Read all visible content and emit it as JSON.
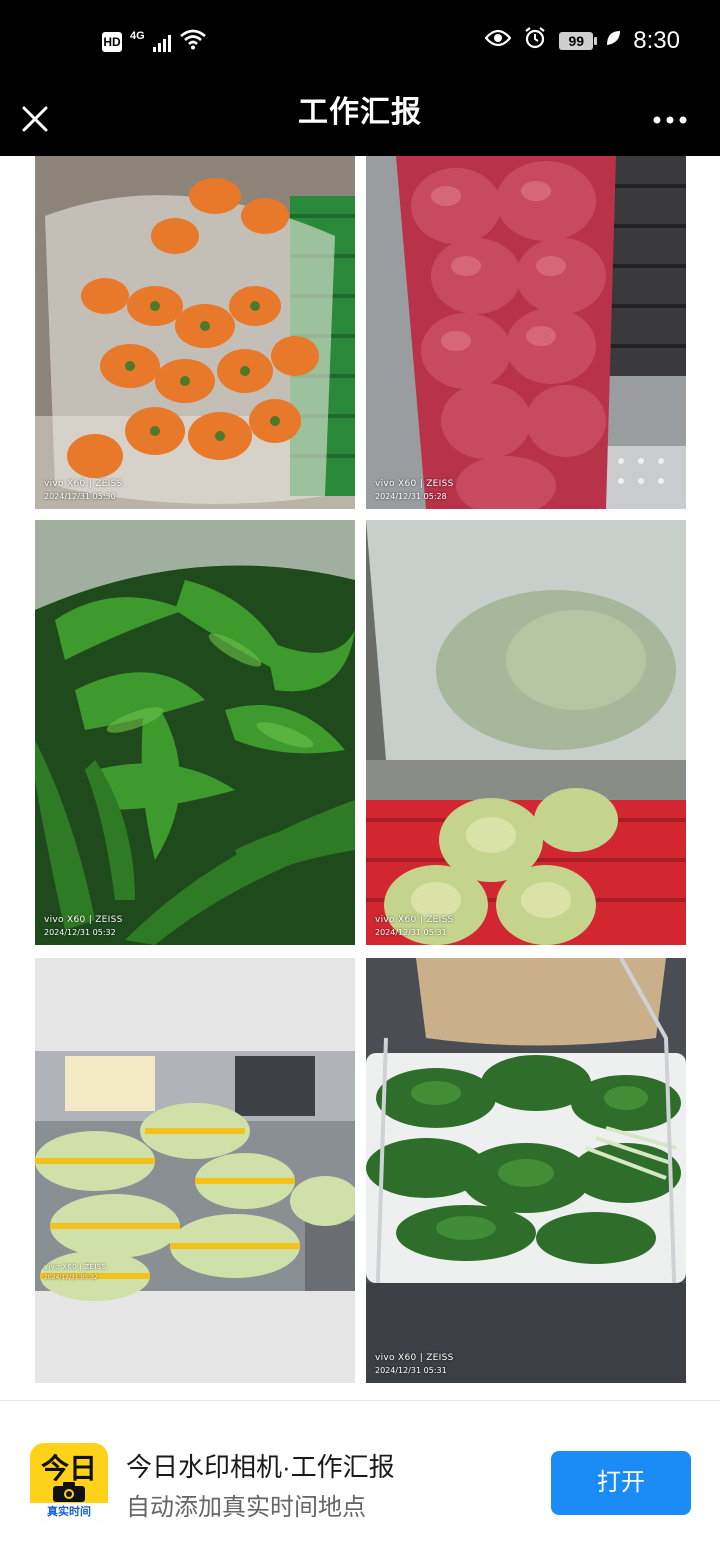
{
  "status_bar": {
    "hd_badge": "HD",
    "network": "4G",
    "battery": "99",
    "time": "8:30"
  },
  "header": {
    "title": "工作汇报",
    "close_icon": "close-icon",
    "more_icon": "more-icon"
  },
  "photos": [
    {
      "subject": "carrots",
      "brand": "vivo X60 | ZEISS",
      "timestamp": "2024/12/31 05:30"
    },
    {
      "subject": "red-onions",
      "brand": "vivo X60 | ZEISS",
      "timestamp": "2024/12/31 05:28"
    },
    {
      "subject": "green-peppers-cucumbers",
      "brand": "vivo X60 | ZEISS",
      "timestamp": "2024/12/31 05:32"
    },
    {
      "subject": "cabbage",
      "brand": "vivo X60 | ZEISS",
      "timestamp": "2024/12/31 05:31"
    },
    {
      "subject": "napa-cabbage",
      "brand": "vivo X60 | ZEISS",
      "timestamp": "2024/12/31 05:32"
    },
    {
      "subject": "bok-choy",
      "brand": "vivo X60 | ZEISS",
      "timestamp": "2024/12/31 05:31"
    }
  ],
  "banner": {
    "icon_text_top": "今日",
    "icon_text_bottom": "真实时间",
    "app_name": "今日水印相机·工作汇报",
    "subtitle": "自动添加真实时间地点",
    "open_button": "打开"
  },
  "colors": {
    "status_bar_bg": "#000000",
    "accent": "#1b8cf6",
    "app_icon": "#ffd21a"
  }
}
